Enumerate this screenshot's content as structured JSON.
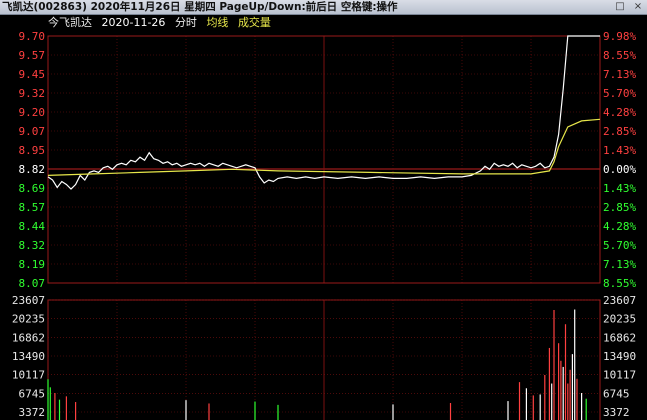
{
  "window": {
    "title": "飞凯达(002863)  2020年11月26日 星期四 PageUp/Down:前后日 空格键:操作",
    "icon": "stock-chart-icon",
    "restore_glyph": "□",
    "close_glyph": "×"
  },
  "header": {
    "stock_name": "今飞凯达",
    "date": "2020-11-26",
    "period": "分时",
    "avg_label": "均线",
    "volume_label": "成交量"
  },
  "colors": {
    "background": "#000000",
    "grid": "#7a1010",
    "border": "#9a1a1a",
    "price_line": "#ffffff",
    "avg_line": "#e6e64a",
    "up": "#ff4040",
    "down": "#30ff30",
    "flat": "#ffffff",
    "info_text": "#e8e8e8",
    "date_text": "#ffffff",
    "avg_label": "#e6e64a",
    "volume_label": "#e6e64a"
  },
  "chart_data": {
    "type": "line",
    "prev_close": 8.82,
    "price_ylim": [
      8.07,
      9.7
    ],
    "left_ticks": [
      "9.70",
      "9.57",
      "9.45",
      "9.32",
      "9.20",
      "9.07",
      "8.95",
      "8.82",
      "8.69",
      "8.57",
      "8.44",
      "8.32",
      "8.19",
      "8.07"
    ],
    "right_ticks": [
      "9.98%",
      "8.55%",
      "7.13%",
      "5.70%",
      "4.28%",
      "2.85%",
      "1.43%",
      "0.00%",
      "1.43%",
      "2.85%",
      "4.28%",
      "5.70%",
      "7.13%",
      "8.55%"
    ],
    "volume_ticks": [
      "23607",
      "20235",
      "16862",
      "13490",
      "10117",
      "6745",
      "3372"
    ],
    "volume_ylim": [
      0,
      23607
    ],
    "x_minutes": [
      0,
      240
    ],
    "series": [
      {
        "name": "分时",
        "x": [
          0,
          2,
          4,
          6,
          8,
          10,
          12,
          14,
          16,
          18,
          20,
          22,
          24,
          26,
          28,
          30,
          32,
          34,
          36,
          38,
          40,
          42,
          44,
          46,
          48,
          50,
          52,
          54,
          56,
          58,
          60,
          62,
          64,
          66,
          68,
          70,
          72,
          74,
          76,
          78,
          80,
          82,
          84,
          86,
          88,
          90,
          92,
          94,
          96,
          98,
          100,
          104,
          108,
          112,
          116,
          120,
          126,
          132,
          138,
          144,
          150,
          156,
          162,
          168,
          174,
          180,
          184,
          188,
          190,
          192,
          194,
          196,
          198,
          200,
          202,
          204,
          206,
          208,
          210,
          212,
          214,
          216,
          218,
          220,
          222,
          224,
          226,
          228,
          240
        ],
        "y": [
          8.77,
          8.75,
          8.7,
          8.74,
          8.72,
          8.69,
          8.72,
          8.78,
          8.75,
          8.8,
          8.81,
          8.8,
          8.83,
          8.84,
          8.82,
          8.85,
          8.86,
          8.85,
          8.88,
          8.87,
          8.9,
          8.88,
          8.93,
          8.89,
          8.88,
          8.86,
          8.87,
          8.85,
          8.86,
          8.84,
          8.85,
          8.86,
          8.85,
          8.86,
          8.84,
          8.86,
          8.85,
          8.84,
          8.86,
          8.85,
          8.84,
          8.83,
          8.84,
          8.85,
          8.84,
          8.83,
          8.77,
          8.73,
          8.75,
          8.74,
          8.76,
          8.77,
          8.76,
          8.77,
          8.76,
          8.77,
          8.76,
          8.77,
          8.76,
          8.77,
          8.76,
          8.76,
          8.77,
          8.76,
          8.77,
          8.77,
          8.78,
          8.81,
          8.84,
          8.82,
          8.86,
          8.84,
          8.85,
          8.84,
          8.86,
          8.83,
          8.85,
          8.84,
          8.83,
          8.84,
          8.86,
          8.83,
          8.84,
          8.9,
          9.05,
          9.35,
          9.7,
          9.7,
          9.7
        ]
      },
      {
        "name": "均线",
        "x": [
          0,
          20,
          40,
          60,
          80,
          100,
          140,
          180,
          200,
          210,
          214,
          218,
          220,
          222,
          226,
          232,
          240
        ],
        "y": [
          8.78,
          8.79,
          8.8,
          8.81,
          8.82,
          8.81,
          8.8,
          8.79,
          8.79,
          8.79,
          8.8,
          8.81,
          8.87,
          8.97,
          9.1,
          9.14,
          9.15
        ]
      }
    ],
    "volume": {
      "x": [
        0,
        1,
        3,
        5,
        8,
        12,
        60,
        70,
        90,
        100,
        150,
        175,
        200,
        205,
        208,
        211,
        214,
        216,
        218,
        219,
        220,
        222,
        223,
        224,
        225,
        226,
        227,
        228,
        229,
        230,
        232,
        234
      ],
      "value": [
        6900,
        5200,
        4000,
        2600,
        3300,
        2100,
        2500,
        1800,
        2200,
        1500,
        1600,
        1900,
        2300,
        6300,
        5000,
        3500,
        3700,
        7800,
        13500,
        6000,
        21500,
        14500,
        10800,
        9500,
        18500,
        6000,
        8900,
        12200,
        21600,
        7000,
        4000,
        2800
      ],
      "dir": [
        "down",
        "down",
        "up",
        "down",
        "up",
        "up",
        "flat",
        "up",
        "down",
        "down",
        "flat",
        "up",
        "flat",
        "up",
        "flat",
        "up",
        "flat",
        "up",
        "up",
        "flat",
        "up",
        "up",
        "up",
        "flat",
        "up",
        "up",
        "up",
        "flat",
        "flat",
        "up",
        "flat",
        "down"
      ]
    }
  }
}
